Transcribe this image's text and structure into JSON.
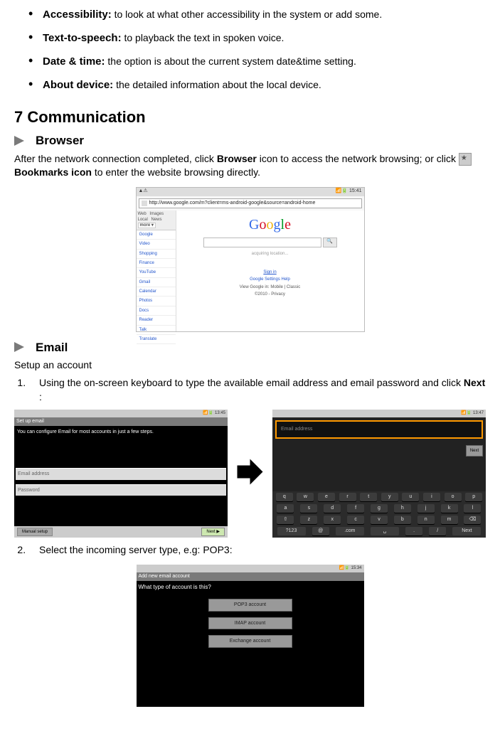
{
  "bullets": [
    {
      "label": "Accessibility:",
      "text": " to look at what other accessibility in the system or add some."
    },
    {
      "label": "Text-to-speech:",
      "text": " to playback the text in spoken voice."
    },
    {
      "label": "Date & time:",
      "text": " the option is about the current system date&time setting."
    },
    {
      "label": "About device:",
      "text": " the detailed information about the local device."
    }
  ],
  "section_heading": "7 Communication",
  "browser_heading": "Browser",
  "browser_para_pre": "After the network connection completed, click ",
  "browser_para_b1": "Browser",
  "browser_para_mid": " icon to access the network browsing; or click  ",
  "bookmarks_label": "Bookmarks icon",
  "browser_para_post": " to enter the website browsing directly.",
  "statusbar_time": "15:41",
  "url": "http://www.google.com/m?client=ms-android-google&source=android-home",
  "tabs": {
    "web": "Web",
    "images": "Images",
    "local": "Local",
    "news": "News",
    "more": "more ▾"
  },
  "side_links": [
    "Google",
    "Video",
    "Shopping",
    "Finance",
    "YouTube",
    "Gmail",
    "Calendar",
    "Photos",
    "Docs",
    "Reader",
    "Talk",
    "Translate"
  ],
  "glogo": "Google",
  "gloc": "acquiring location...",
  "glinks": {
    "signin": "Sign in",
    "row2": "Google   Settings   Help",
    "row3": "View Google in: Mobile | Classic",
    "row4": "©2010 - Privacy"
  },
  "email_heading": "Email",
  "email_setup": "Setup an account",
  "email_steps": [
    {
      "pre": "Using the on-screen keyboard to type the available email address and email password and click ",
      "b": "Next",
      "post": " :"
    },
    {
      "pre": "Select the incoming server type, e.g: POP3:",
      "b": "",
      "post": ""
    }
  ],
  "shot1": {
    "time": "13:45",
    "title": "Set up email",
    "msg": "You can configure Email for most accounts in just a few steps.",
    "f1": "Email address",
    "f2": "Password",
    "manual": "Manual setup",
    "next": "Next"
  },
  "shot2": {
    "time": "13:47",
    "placeholder": "Email address",
    "next": "Next",
    "rows": [
      [
        "q",
        "w",
        "e",
        "r",
        "t",
        "y",
        "u",
        "i",
        "o",
        "p"
      ],
      [
        "a",
        "s",
        "d",
        "f",
        "g",
        "h",
        "j",
        "k",
        "l"
      ],
      [
        "⇧",
        "z",
        "x",
        "c",
        "v",
        "b",
        "n",
        "m",
        "⌫"
      ]
    ],
    "bottom": [
      "?123",
      "@",
      ".com",
      "␣",
      ".",
      "/",
      "Next"
    ]
  },
  "shot3": {
    "time": "15:34",
    "title": "Add new email account",
    "q": "What type of account is this?",
    "opts": [
      "POP3 account",
      "IMAP account",
      "Exchange account"
    ]
  }
}
